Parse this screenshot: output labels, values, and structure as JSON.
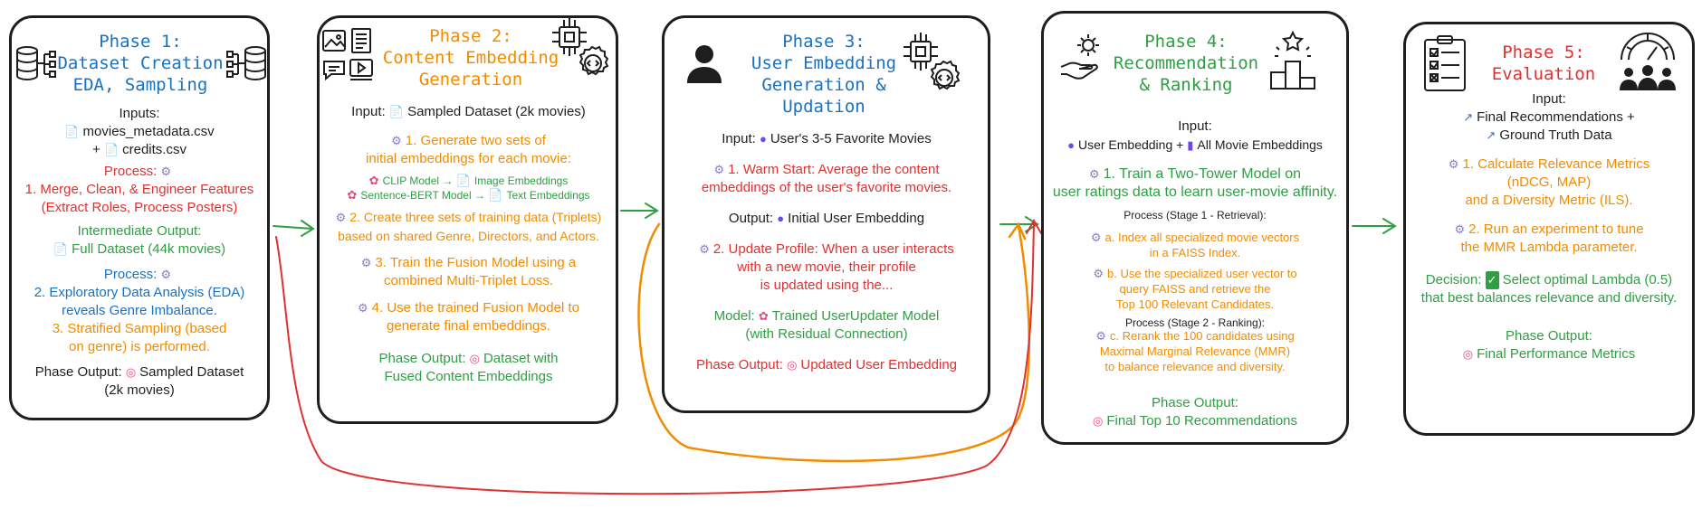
{
  "colors": {
    "blue": "#1971c2",
    "orange": "#f08c00",
    "green": "#2f9e44",
    "red": "#e03131",
    "black": "#1e1e1e"
  },
  "phase1": {
    "title1": "Phase 1:",
    "title2": "Dataset Creation",
    "title3": "EDA, Sampling",
    "inputs_label": "Inputs:",
    "input_file1": "movies_metadata.csv",
    "input_plus": "+",
    "input_file2": "credits.csv",
    "process_label": "Process:",
    "process_text1": "1. Merge, Clean, & Engineer Features",
    "process_text2": "(Extract Roles, Process Posters)",
    "inter_label": "Intermediate Output:",
    "inter_value": "Full Dataset (44k movies)",
    "process2_label": "Process:",
    "eda1": "2. Exploratory Data Analysis (EDA)",
    "eda2": "reveals Genre Imbalance.",
    "strat1": "3. Stratified Sampling (based",
    "strat2": "on genre) is performed.",
    "output_label": "Phase Output:",
    "output_value1": "Sampled Dataset",
    "output_value2": "(2k movies)"
  },
  "phase2": {
    "title1": "Phase 2:",
    "title2": "Content Embedding",
    "title3": "Generation",
    "input_label": "Input:",
    "input_value": "Sampled Dataset (2k movies)",
    "step1a": "1. Generate two sets of",
    "step1b": "initial embeddings for each movie:",
    "clip_model": "CLIP Model",
    "clip_out": "Image Embeddings",
    "sbert_model": "Sentence-BERT Model",
    "sbert_out": "Text Embeddings",
    "arrow": "→",
    "step2a": "2. Create three sets of  training data (Triplets)",
    "step2b": "based on shared Genre, Directors, and Actors.",
    "step3a": "3. Train the Fusion Model using a",
    "step3b": "combined Multi-Triplet Loss.",
    "step4a": "4. Use the trained Fusion Model to",
    "step4b": "generate final embeddings.",
    "output_label": "Phase Output:",
    "output_value1": "Dataset with",
    "output_value2": "Fused Content Embeddings"
  },
  "phase3": {
    "title1": "Phase 3:",
    "title2": "User Embedding",
    "title3": "Generation &",
    "title4": "Updation",
    "input_label": "Input:",
    "input_value": "User's 3-5 Favorite Movies",
    "warm1": "1. Warm Start: Average the content",
    "warm2": "embeddings of the user's favorite movies.",
    "output_label": "Output:",
    "output_value": "Initial User Embedding",
    "upd1": "2. Update Profile: When a user interacts",
    "upd2": "with a new movie, their profile",
    "upd3": "is updated using the...",
    "model_label": "Model:",
    "model_value1": "Trained UserUpdater Model",
    "model_value2": "(with Residual Connection)",
    "phase_output_label": "Phase Output:",
    "phase_output_value": "Updated User Embedding"
  },
  "phase4": {
    "title1": "Phase 4:",
    "title2": "Recommendation",
    "title3": "& Ranking",
    "input_label": "Input:",
    "input_value1": "User Embedding",
    "input_plus": "+",
    "input_value2": "All Movie Embeddings",
    "train1": "1. Train a Two-Tower Model on",
    "train2": "user ratings data to learn user-movie affinity.",
    "stage1": "Process (Stage 1 - Retrieval):",
    "a1": "a. Index all specialized movie vectors",
    "a2": "in a FAISS Index.",
    "b1": "b. Use the specialized user vector to",
    "b2": "query FAISS and retrieve the",
    "b3": "Top 100 Relevant Candidates.",
    "stage2": "Process (Stage 2 - Ranking):",
    "c1": "c. Rerank the 100 candidates using",
    "c2": "Maximal Marginal Relevance (MMR)",
    "c3": "to balance relevance and diversity.",
    "output_label": "Phase Output:",
    "output_value": "Final Top 10 Recommendations"
  },
  "phase5": {
    "title1": "Phase 5:",
    "title2": "Evaluation",
    "input_label": "Input:",
    "input_value1": "Final Recommendations +",
    "input_value2": "Ground Truth Data",
    "m1": "1. Calculate Relevance Metrics",
    "m2": "(nDCG, MAP)",
    "m3": "and a Diversity Metric (ILS).",
    "e1": "2. Run an experiment to tune",
    "e2": "the MMR Lambda parameter.",
    "decision_label": "Decision:",
    "decision1": "Select optimal Lambda (0.5)",
    "decision2": "that best balances relevance and diversity.",
    "output_label": "Phase Output:",
    "output_value": "Final Performance Metrics"
  },
  "icons": [
    "database-icon",
    "image-icon",
    "document-icon",
    "chat-icon",
    "video-icon",
    "chip-icon",
    "code-gear-icon",
    "user-icon",
    "gear-hand-icon",
    "podium-icon",
    "checklist-icon",
    "gauge-icon",
    "group-icon",
    "gear-icon",
    "file-icon",
    "target-icon",
    "brain-icon",
    "chart-icon",
    "checkmark-icon",
    "movie-icon"
  ]
}
